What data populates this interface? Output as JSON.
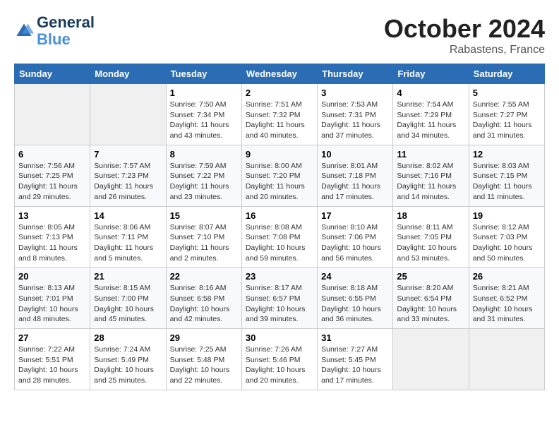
{
  "header": {
    "logo_line1": "General",
    "logo_line2": "Blue",
    "month": "October 2024",
    "location": "Rabastens, France"
  },
  "weekdays": [
    "Sunday",
    "Monday",
    "Tuesday",
    "Wednesday",
    "Thursday",
    "Friday",
    "Saturday"
  ],
  "weeks": [
    [
      {
        "day": "",
        "info": ""
      },
      {
        "day": "",
        "info": ""
      },
      {
        "day": "1",
        "info": "Sunrise: 7:50 AM\nSunset: 7:34 PM\nDaylight: 11 hours and 43 minutes."
      },
      {
        "day": "2",
        "info": "Sunrise: 7:51 AM\nSunset: 7:32 PM\nDaylight: 11 hours and 40 minutes."
      },
      {
        "day": "3",
        "info": "Sunrise: 7:53 AM\nSunset: 7:31 PM\nDaylight: 11 hours and 37 minutes."
      },
      {
        "day": "4",
        "info": "Sunrise: 7:54 AM\nSunset: 7:29 PM\nDaylight: 11 hours and 34 minutes."
      },
      {
        "day": "5",
        "info": "Sunrise: 7:55 AM\nSunset: 7:27 PM\nDaylight: 11 hours and 31 minutes."
      }
    ],
    [
      {
        "day": "6",
        "info": "Sunrise: 7:56 AM\nSunset: 7:25 PM\nDaylight: 11 hours and 29 minutes."
      },
      {
        "day": "7",
        "info": "Sunrise: 7:57 AM\nSunset: 7:23 PM\nDaylight: 11 hours and 26 minutes."
      },
      {
        "day": "8",
        "info": "Sunrise: 7:59 AM\nSunset: 7:22 PM\nDaylight: 11 hours and 23 minutes."
      },
      {
        "day": "9",
        "info": "Sunrise: 8:00 AM\nSunset: 7:20 PM\nDaylight: 11 hours and 20 minutes."
      },
      {
        "day": "10",
        "info": "Sunrise: 8:01 AM\nSunset: 7:18 PM\nDaylight: 11 hours and 17 minutes."
      },
      {
        "day": "11",
        "info": "Sunrise: 8:02 AM\nSunset: 7:16 PM\nDaylight: 11 hours and 14 minutes."
      },
      {
        "day": "12",
        "info": "Sunrise: 8:03 AM\nSunset: 7:15 PM\nDaylight: 11 hours and 11 minutes."
      }
    ],
    [
      {
        "day": "13",
        "info": "Sunrise: 8:05 AM\nSunset: 7:13 PM\nDaylight: 11 hours and 8 minutes."
      },
      {
        "day": "14",
        "info": "Sunrise: 8:06 AM\nSunset: 7:11 PM\nDaylight: 11 hours and 5 minutes."
      },
      {
        "day": "15",
        "info": "Sunrise: 8:07 AM\nSunset: 7:10 PM\nDaylight: 11 hours and 2 minutes."
      },
      {
        "day": "16",
        "info": "Sunrise: 8:08 AM\nSunset: 7:08 PM\nDaylight: 10 hours and 59 minutes."
      },
      {
        "day": "17",
        "info": "Sunrise: 8:10 AM\nSunset: 7:06 PM\nDaylight: 10 hours and 56 minutes."
      },
      {
        "day": "18",
        "info": "Sunrise: 8:11 AM\nSunset: 7:05 PM\nDaylight: 10 hours and 53 minutes."
      },
      {
        "day": "19",
        "info": "Sunrise: 8:12 AM\nSunset: 7:03 PM\nDaylight: 10 hours and 50 minutes."
      }
    ],
    [
      {
        "day": "20",
        "info": "Sunrise: 8:13 AM\nSunset: 7:01 PM\nDaylight: 10 hours and 48 minutes."
      },
      {
        "day": "21",
        "info": "Sunrise: 8:15 AM\nSunset: 7:00 PM\nDaylight: 10 hours and 45 minutes."
      },
      {
        "day": "22",
        "info": "Sunrise: 8:16 AM\nSunset: 6:58 PM\nDaylight: 10 hours and 42 minutes."
      },
      {
        "day": "23",
        "info": "Sunrise: 8:17 AM\nSunset: 6:57 PM\nDaylight: 10 hours and 39 minutes."
      },
      {
        "day": "24",
        "info": "Sunrise: 8:18 AM\nSunset: 6:55 PM\nDaylight: 10 hours and 36 minutes."
      },
      {
        "day": "25",
        "info": "Sunrise: 8:20 AM\nSunset: 6:54 PM\nDaylight: 10 hours and 33 minutes."
      },
      {
        "day": "26",
        "info": "Sunrise: 8:21 AM\nSunset: 6:52 PM\nDaylight: 10 hours and 31 minutes."
      }
    ],
    [
      {
        "day": "27",
        "info": "Sunrise: 7:22 AM\nSunset: 5:51 PM\nDaylight: 10 hours and 28 minutes."
      },
      {
        "day": "28",
        "info": "Sunrise: 7:24 AM\nSunset: 5:49 PM\nDaylight: 10 hours and 25 minutes."
      },
      {
        "day": "29",
        "info": "Sunrise: 7:25 AM\nSunset: 5:48 PM\nDaylight: 10 hours and 22 minutes."
      },
      {
        "day": "30",
        "info": "Sunrise: 7:26 AM\nSunset: 5:46 PM\nDaylight: 10 hours and 20 minutes."
      },
      {
        "day": "31",
        "info": "Sunrise: 7:27 AM\nSunset: 5:45 PM\nDaylight: 10 hours and 17 minutes."
      },
      {
        "day": "",
        "info": ""
      },
      {
        "day": "",
        "info": ""
      }
    ]
  ]
}
